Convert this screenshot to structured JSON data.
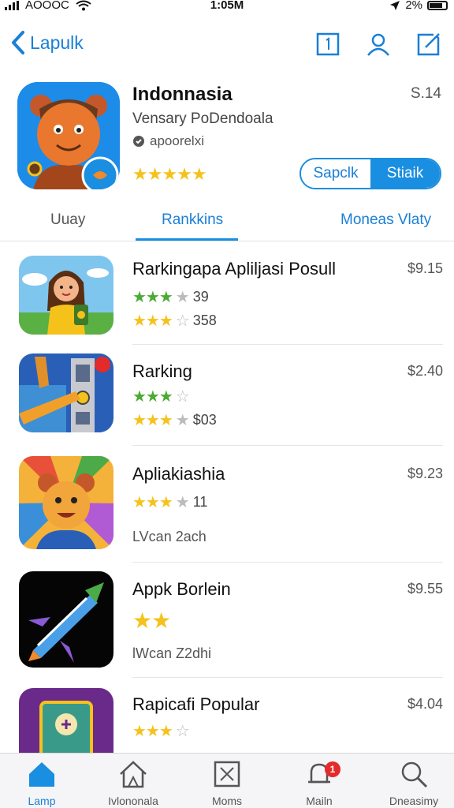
{
  "status_bar": {
    "carrier": "AOOOC",
    "time": "1:05M",
    "battery": "2%"
  },
  "nav": {
    "back_label": "Lapulk"
  },
  "app": {
    "title": "Indonnasia",
    "subtitle": "Vensary PoDendoala",
    "developer": "apoorelxi",
    "price": "S.14",
    "segment_left": "Sapclk",
    "segment_right": "Stiaik",
    "rating_stars": 5
  },
  "tabs": [
    "Uuay",
    "Rankkins",
    "Moneas Vlaty"
  ],
  "active_tab": 1,
  "list": [
    {
      "title": "Rarkingapa Apliljasi Posull",
      "price": "$9.15",
      "rating_a": "39",
      "rating_b": "358",
      "sub": ""
    },
    {
      "title": "Rarking",
      "price": "$2.40",
      "rating_a": "",
      "rating_b": "$03",
      "sub": ""
    },
    {
      "title": "Apliakiashia",
      "price": "$9.23",
      "rating_a": "11",
      "rating_b": "",
      "sub": "LVcan 2ach"
    },
    {
      "title": "Appk Borlein",
      "price": "$9.55",
      "rating_a": "",
      "rating_b": "",
      "sub": "lWcan Z2dhi"
    },
    {
      "title": "Rapicafi Popular",
      "price": "$4.04",
      "rating_a": "",
      "rating_b": "",
      "sub": ""
    }
  ],
  "tab_bar": [
    {
      "label": "Lamp",
      "icon": "home-icon"
    },
    {
      "label": "Ivlononala",
      "icon": "house-outline-icon"
    },
    {
      "label": "Moms",
      "icon": "checkbox-icon"
    },
    {
      "label": "Mailn",
      "icon": "bell-icon",
      "badge": "1"
    },
    {
      "label": "Dneasimy",
      "icon": "search-icon"
    }
  ],
  "colors": {
    "accent": "#1a8ee0",
    "star": "#f5c21b",
    "star_green": "#4aaa32",
    "badge": "#e32b2b"
  }
}
